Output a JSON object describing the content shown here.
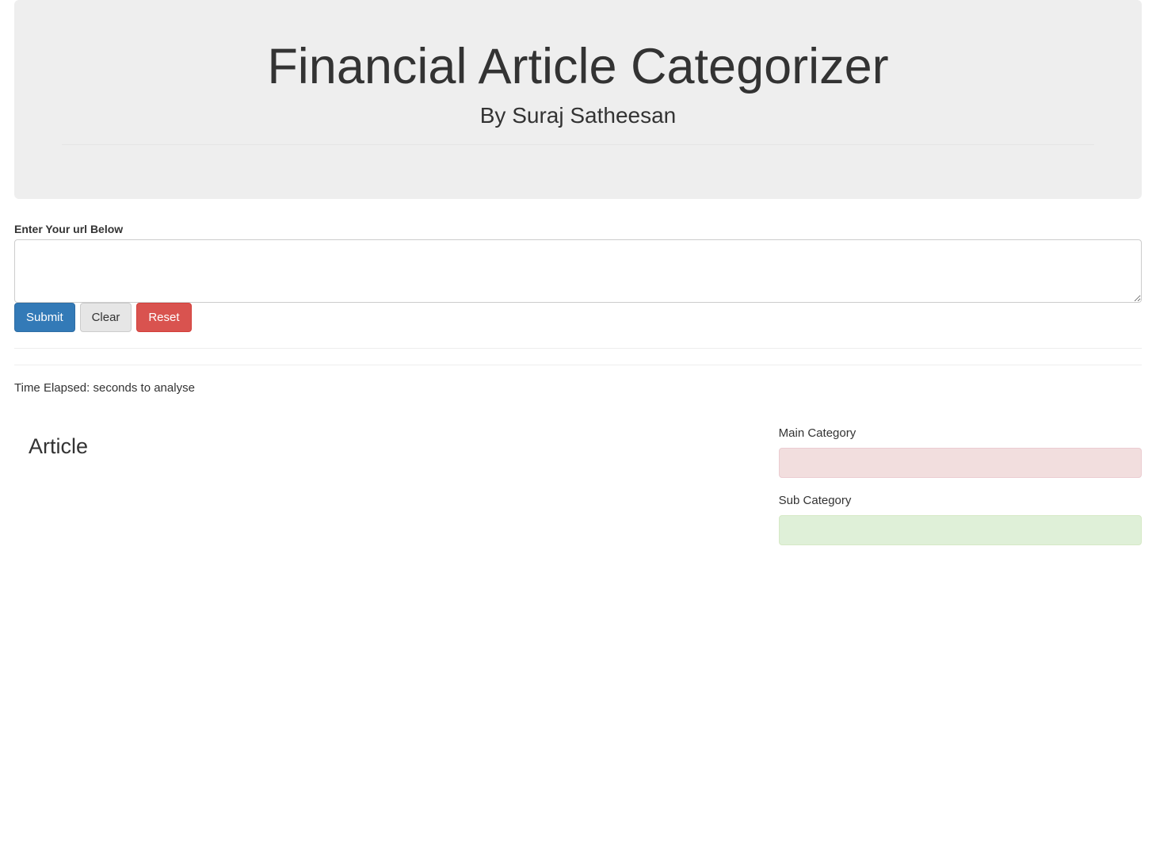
{
  "header": {
    "title": "Financial Article Categorizer",
    "subtitle": "By Suraj Satheesan"
  },
  "form": {
    "url_label": "Enter Your url Below",
    "url_value": "",
    "submit_label": "Submit",
    "clear_label": "Clear",
    "reset_label": "Reset"
  },
  "results": {
    "time_elapsed_prefix": "Time Elapsed: ",
    "time_elapsed_value": "",
    "time_elapsed_suffix": " seconds to analyse",
    "article_heading": "Article",
    "main_category_label": "Main Category",
    "main_category_value": "",
    "sub_category_label": "Sub Category",
    "sub_category_value": ""
  },
  "colors": {
    "jumbotron_bg": "#eeeeee",
    "btn_primary": "#337ab7",
    "btn_default": "#e6e6e6",
    "btn_danger": "#d9534f",
    "alert_danger_bg": "#f2dede",
    "alert_success_bg": "#dff0d8"
  }
}
